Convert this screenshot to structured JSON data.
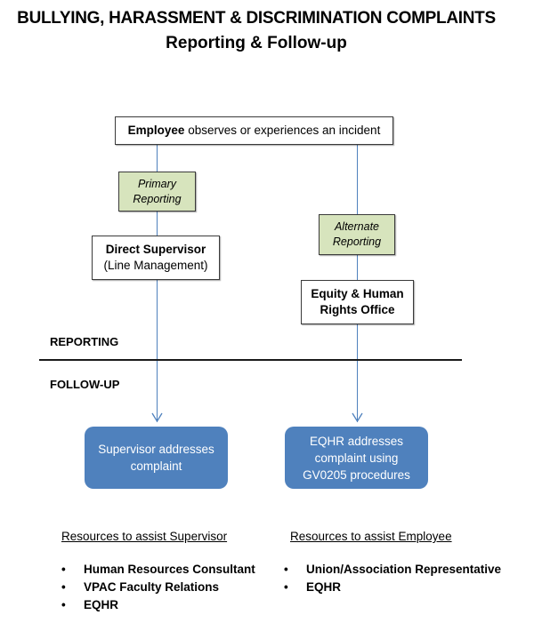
{
  "title": {
    "line1": "BULLYING, HARASSMENT & DISCRIMINATION COMPLAINTS",
    "line2": "Reporting & Follow-up"
  },
  "nodes": {
    "employee": {
      "bold": "Employee",
      "rest": " observes or experiences an incident"
    },
    "primary_reporting": {
      "line1": "Primary",
      "line2": "Reporting"
    },
    "alternate_reporting": {
      "line1": "Alternate",
      "line2": "Reporting"
    },
    "direct_supervisor": {
      "line1": "Direct Supervisor",
      "line2": "(Line Management)"
    },
    "equity_office": {
      "line1": "Equity & Human",
      "line2": "Rights Office"
    },
    "supervisor_addresses": {
      "line1": "Supervisor addresses",
      "line2": "complaint"
    },
    "eqhr_addresses": {
      "line1": "EQHR addresses",
      "line2": "complaint using",
      "line3": "GV0205 procedures"
    }
  },
  "sections": {
    "reporting": "REPORTING",
    "follow_up": "FOLLOW-UP"
  },
  "resources": {
    "supervisor": {
      "heading": "Resources to assist Supervisor",
      "items": [
        "Human Resources Consultant",
        "VPAC Faculty Relations",
        "EQHR"
      ]
    },
    "employee": {
      "heading": "Resources to assist Employee",
      "items": [
        "Union/Association Representative",
        "EQHR"
      ]
    }
  },
  "bullet": "•",
  "colors": {
    "connector": "#4f81bd",
    "reporting_box": "#d7e4bd",
    "action_box": "#4f81bd"
  }
}
